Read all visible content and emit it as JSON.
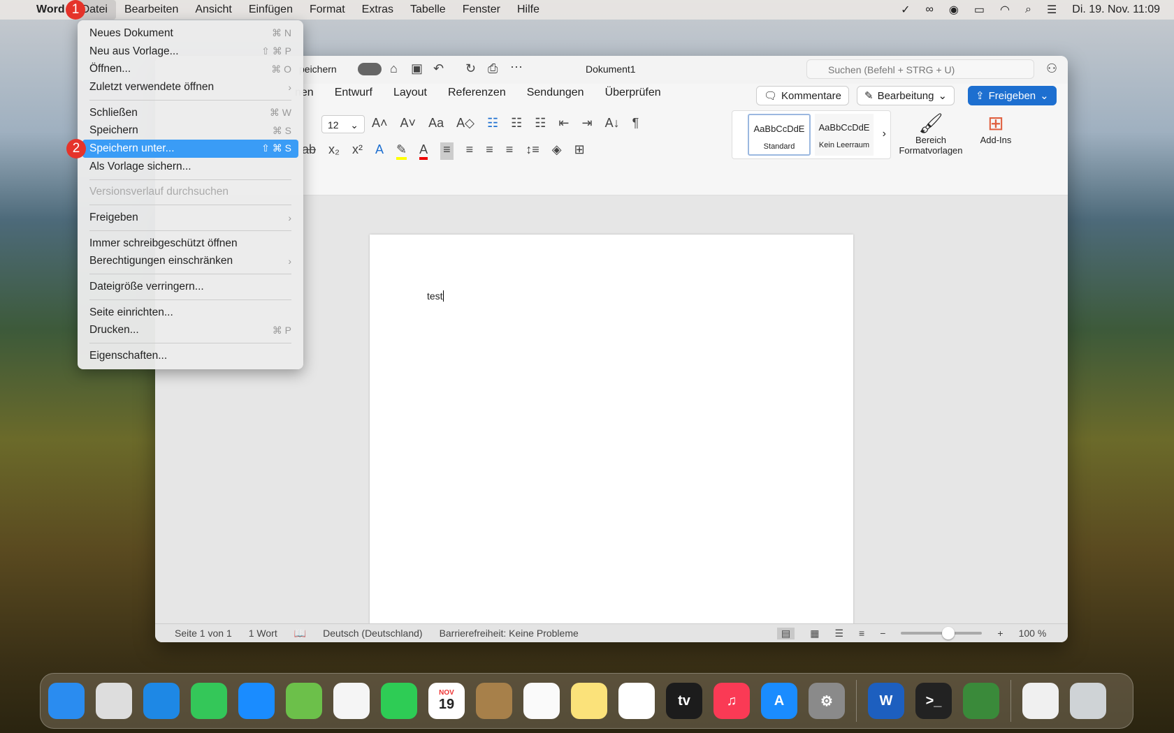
{
  "menubar": {
    "app": "Word",
    "items": [
      "Datei",
      "Bearbeiten",
      "Ansicht",
      "Einfügen",
      "Format",
      "Extras",
      "Tabelle",
      "Fenster",
      "Hilfe"
    ],
    "clock": "Di. 19. Nov.  11:09"
  },
  "badges": [
    "1",
    "2"
  ],
  "file_menu": [
    {
      "label": "Neues Dokument",
      "shortcut": "⌘ N"
    },
    {
      "label": "Neu aus Vorlage...",
      "shortcut": "⇧ ⌘ P"
    },
    {
      "label": "Öffnen...",
      "shortcut": "⌘ O"
    },
    {
      "label": "Zuletzt verwendete öffnen",
      "shortcut": "›"
    },
    {
      "sep": true
    },
    {
      "label": "Schließen",
      "shortcut": "⌘ W"
    },
    {
      "label": "Speichern",
      "shortcut": "⌘ S"
    },
    {
      "label": "Speichern unter...",
      "shortcut": "⇧ ⌘ S",
      "highlighted": true
    },
    {
      "label": "Als Vorlage sichern...",
      "shortcut": ""
    },
    {
      "sep": true
    },
    {
      "label": "Versionsverlauf durchsuchen",
      "shortcut": "",
      "disabled": true
    },
    {
      "sep": true
    },
    {
      "label": "Freigeben",
      "shortcut": "›"
    },
    {
      "sep": true
    },
    {
      "label": "Immer schreibgeschützt öffnen",
      "shortcut": ""
    },
    {
      "label": "Berechtigungen einschränken",
      "shortcut": "›"
    },
    {
      "sep": true
    },
    {
      "label": "Dateigröße verringern...",
      "shortcut": ""
    },
    {
      "sep": true
    },
    {
      "label": "Seite einrichten...",
      "shortcut": ""
    },
    {
      "label": "Drucken...",
      "shortcut": "⌘ P"
    },
    {
      "sep": true
    },
    {
      "label": "Eigenschaften...",
      "shortcut": ""
    }
  ],
  "window": {
    "autosave": "peichern",
    "title": "Dokument1",
    "search_placeholder": "Suchen (Befehl + STRG + U)",
    "tabs": [
      "nen",
      "Entwurf",
      "Layout",
      "Referenzen",
      "Sendungen",
      "Überprüfen"
    ],
    "comments": "Kommentare",
    "editing": "Bearbeitung",
    "share": "Freigeben",
    "font_size": "12",
    "styles": [
      "AaBbCcDdE",
      "AaBbCcDdE"
    ],
    "style_names": [
      "Standard",
      "Kein Leerraum"
    ],
    "styles_pane": "Bereich Formatvorlagen",
    "addins": "Add-Ins"
  },
  "document": {
    "text": "test"
  },
  "status": {
    "page": "Seite 1 von 1",
    "words": "1 Wort",
    "language": "Deutsch (Deutschland)",
    "accessibility": "Barrierefreiheit: Keine Probleme",
    "zoom": "100 %",
    "zoom_percent": 100
  },
  "dock": [
    {
      "name": "Finder",
      "color": "#2a8cf0"
    },
    {
      "name": "Launchpad",
      "color": "#ddd"
    },
    {
      "name": "Safari",
      "color": "#1e88e5"
    },
    {
      "name": "Nachrichten",
      "color": "#34c759"
    },
    {
      "name": "Mail",
      "color": "#1a8cff"
    },
    {
      "name": "Karten",
      "color": "#6cc04a"
    },
    {
      "name": "Fotos",
      "color": "#f5f5f5"
    },
    {
      "name": "FaceTime",
      "color": "#2ecc55"
    },
    {
      "name": "Kalender",
      "color": "#fff",
      "label": "19",
      "month": "NOV"
    },
    {
      "name": "Kontakte",
      "color": "#a7804a"
    },
    {
      "name": "Erinnerungen",
      "color": "#fafafa"
    },
    {
      "name": "Notizen",
      "color": "#fbe27a"
    },
    {
      "name": "Freeform",
      "color": "#fff"
    },
    {
      "name": "TV",
      "color": "#1c1c1c",
      "label": "tv"
    },
    {
      "name": "Musik",
      "color": "#fa3a55",
      "label": "♫"
    },
    {
      "name": "App Store",
      "color": "#1a8cff",
      "label": "A"
    },
    {
      "name": "Systemeinstellungen",
      "color": "#8a8a8a",
      "label": "⚙"
    },
    {
      "sep": true
    },
    {
      "name": "Word",
      "color": "#1d5fbf",
      "label": "W"
    },
    {
      "name": "Terminal",
      "color": "#222",
      "label": ">_"
    },
    {
      "name": "KeePass",
      "color": "#3a8a3a"
    },
    {
      "sep": true
    },
    {
      "name": "Dokument",
      "color": "#f0f0f0"
    },
    {
      "name": "Papierkorb",
      "color": "#cfd3d6"
    }
  ]
}
